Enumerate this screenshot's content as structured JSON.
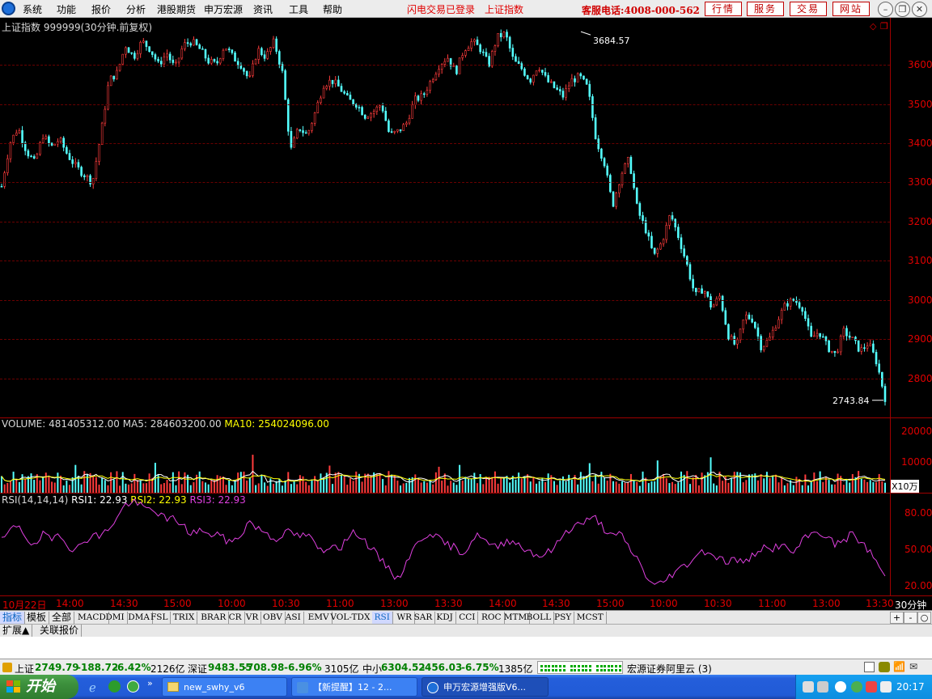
{
  "menubar": {
    "items": [
      "系统",
      "功能",
      "报价",
      "分析",
      "港股期货",
      "申万宏源",
      "资讯",
      "工具",
      "帮助"
    ],
    "links": [
      "闪电交易已登录",
      "上证指数"
    ],
    "hotline": "客服电话:4008-000-562",
    "buttons": [
      "行情",
      "服务",
      "交易",
      "网站"
    ]
  },
  "price_panel": {
    "title": "上证指数 999999(30分钟.前复权)",
    "high_note": "3684.57",
    "low_note": "2743.84",
    "y_ticks": [
      "3600",
      "3500",
      "3400",
      "3300",
      "3200",
      "3100",
      "3000",
      "2900",
      "2800"
    ]
  },
  "volume_panel": {
    "title": "VOLUME: 481405312.00",
    "ma5": "MA5: 284603200.00",
    "ma10": "MA10: 254024096.00",
    "y_ticks": [
      "20000",
      "10000"
    ],
    "unit": "X10万"
  },
  "rsi_panel": {
    "title": "RSI(14,14,14)",
    "rsi1": "RSI1: 22.93",
    "rsi2": "RSI2: 22.93",
    "rsi3": "RSI3: 22.93",
    "y_ticks": [
      "80.00",
      "50.00",
      "20.00"
    ]
  },
  "time_axis": {
    "labels": [
      "10月22日",
      "14:00",
      "14:30",
      "15:00",
      "10:00",
      "10:30",
      "11:00",
      "13:00",
      "13:30",
      "14:00",
      "14:30",
      "15:00",
      "10:00",
      "10:30",
      "11:00",
      "13:00",
      "13:30"
    ],
    "period": "30分钟"
  },
  "indicator_tabs": {
    "lead": [
      "指标",
      "模板",
      "全部"
    ],
    "items": [
      "MACD",
      "DMI",
      "DMA",
      "FSL",
      "TRIX",
      "BRAR",
      "CR",
      "VR",
      "OBV",
      "ASI",
      "EMV",
      "VOL-TDX",
      "RSI",
      "WR",
      "SAR",
      "KDJ",
      "CCI",
      "ROC",
      "MTM",
      "BOLL",
      "PSY",
      "MCST"
    ],
    "active": "RSI",
    "buttons": [
      "+",
      "-",
      "○"
    ]
  },
  "ext_tabs": [
    "扩展▲",
    "关联报价"
  ],
  "status": {
    "sh_label": "上证",
    "sh_value": "2749.79",
    "sh_change": "-188.72",
    "sh_pct": "-6.42%",
    "sh_amount": "2126亿",
    "sz_label": "深证",
    "sz_value": "9483.55",
    "sz_change": "-708.98",
    "sz_pct": "-6.96%",
    "sz_amount": "3105亿",
    "zx_label": "中小",
    "zx_value": "6304.52",
    "zx_change": "-456.03",
    "zx_pct": "-6.75%",
    "zx_amount": "1385亿",
    "broker": "宏源证券阿里云 (3)"
  },
  "taskbar": {
    "start": "开始",
    "items": [
      "new_swhy_v6",
      "【新提醒】12 - 2...",
      "申万宏源增强版V6..."
    ],
    "clock": "20:17"
  },
  "chart_data": {
    "type": "candlestick",
    "title": "上证指数 999999(30分钟.前复权)",
    "ylim": [
      2700,
      3720
    ],
    "high": 3684.57,
    "low": 2743.84,
    "close_path": [
      3290,
      3400,
      3440,
      3380,
      3350,
      3420,
      3390,
      3410,
      3370,
      3340,
      3320,
      3300,
      3420,
      3560,
      3580,
      3650,
      3620,
      3660,
      3640,
      3600,
      3630,
      3590,
      3650,
      3660,
      3640,
      3610,
      3600,
      3650,
      3620,
      3600,
      3560,
      3640,
      3620,
      3660,
      3580,
      3380,
      3440,
      3420,
      3480,
      3550,
      3560,
      3540,
      3510,
      3500,
      3470,
      3480,
      3500,
      3420,
      3430,
      3450,
      3510,
      3520,
      3560,
      3600,
      3620,
      3580,
      3640,
      3660,
      3640,
      3600,
      3670,
      3680,
      3610,
      3590,
      3560,
      3600,
      3560,
      3540,
      3520,
      3560,
      3570,
      3540,
      3410,
      3350,
      3240,
      3320,
      3360,
      3230,
      3180,
      3110,
      3150,
      3220,
      3160,
      3090,
      3010,
      3030,
      2980,
      3010,
      2910,
      2880,
      2960,
      2950,
      2880,
      2900,
      2950,
      2990,
      3000,
      2980,
      2900,
      2920,
      2880,
      2860,
      2920,
      2900,
      2870,
      2890,
      2840,
      2750
    ],
    "volume_ylim": [
      0,
      22000
    ],
    "rsi_ylim": [
      15,
      90
    ],
    "rsi_path": [
      55,
      62,
      68,
      58,
      50,
      60,
      55,
      62,
      52,
      48,
      55,
      60,
      58,
      65,
      72,
      82,
      84,
      80,
      78,
      76,
      70,
      72,
      66,
      60,
      64,
      58,
      62,
      56,
      54,
      60,
      70,
      64,
      62,
      56,
      60,
      62,
      58,
      60,
      52,
      46,
      54,
      50,
      58,
      62,
      55,
      48,
      40,
      35,
      26,
      40,
      50,
      58,
      62,
      56,
      52,
      50,
      46,
      56,
      60,
      52,
      50,
      55,
      56,
      50,
      48,
      44,
      46,
      50,
      60,
      65,
      68,
      70,
      72,
      64,
      58,
      60,
      50,
      42,
      30,
      22,
      24,
      30,
      34,
      38,
      44,
      48,
      46,
      42,
      40,
      42,
      38,
      45,
      50,
      48,
      52,
      50,
      46,
      55,
      60,
      62,
      58,
      52,
      56,
      60,
      55,
      48,
      40,
      28
    ]
  }
}
